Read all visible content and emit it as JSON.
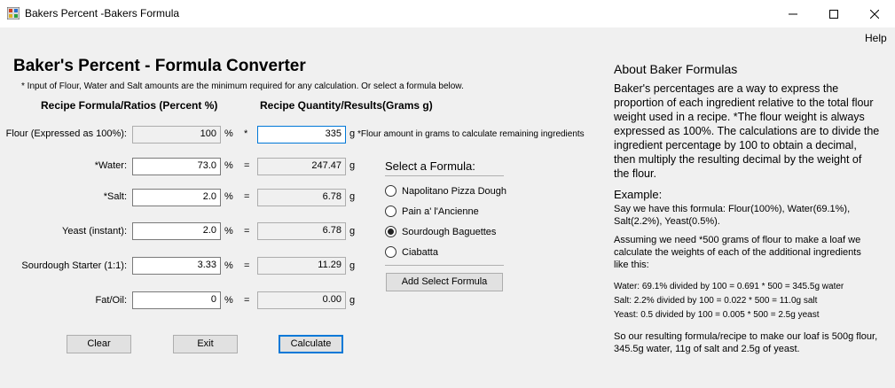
{
  "window": {
    "title": "Bakers Percent -Bakers Formula"
  },
  "menu": {
    "help": "Help"
  },
  "header": {
    "title": "Baker's Percent - Formula Converter",
    "note": "* Input of Flour, Water and Salt amounts are the minimum required for any calculation. Or select a formula below."
  },
  "columns": {
    "ratios": "Recipe Formula/Ratios (Percent %)",
    "results": "Recipe Quantity/Results(Grams g)"
  },
  "rows": [
    {
      "label": "Flour (Expressed as 100%):",
      "percent": "100",
      "pct_sym": "%",
      "op": "*",
      "grams": "335",
      "g_sym": "g"
    },
    {
      "label": "*Water:",
      "percent": "73.0",
      "pct_sym": "%",
      "op": "=",
      "grams": "247.47",
      "g_sym": "g"
    },
    {
      "label": "*Salt:",
      "percent": "2.0",
      "pct_sym": "%",
      "op": "=",
      "grams": "6.78",
      "g_sym": "g"
    },
    {
      "label": "Yeast (instant):",
      "percent": "2.0",
      "pct_sym": "%",
      "op": "=",
      "grams": "6.78",
      "g_sym": "g"
    },
    {
      "label": "Sourdough Starter (1:1):",
      "percent": "3.33",
      "pct_sym": "%",
      "op": "=",
      "grams": "11.29",
      "g_sym": "g"
    },
    {
      "label": "Fat/Oil:",
      "percent": "0",
      "pct_sym": "%",
      "op": "=",
      "grams": "0.00",
      "g_sym": "g"
    }
  ],
  "flour_hint": "*Flour amount in grams to calculate remaining ingredients",
  "formula": {
    "title": "Select a Formula:",
    "options": [
      {
        "label": "Napolitano Pizza Dough",
        "selected": false
      },
      {
        "label": "Pain a' l'Ancienne",
        "selected": false
      },
      {
        "label": "Sourdough Baguettes",
        "selected": true
      },
      {
        "label": "Ciabatta",
        "selected": false
      }
    ],
    "add_button": "Add Select Formula"
  },
  "buttons": {
    "clear": "Clear",
    "exit": "Exit",
    "calculate": "Calculate"
  },
  "about": {
    "title": "About Baker Formulas",
    "body": "Baker's percentages are a way to express the proportion of each ingredient relative to the total flour weight used in a recipe. *The flour weight is always expressed as 100%. The calculations are to divide the ingredient percentage by 100 to obtain a decimal, then multiply the resulting decimal by the weight of the flour.",
    "example_title": "Example:",
    "example_intro": "Say we have this formula: Flour(100%), Water(69.1%), Salt(2.2%), Yeast(0.5%).",
    "assumption": "Assuming we need *500 grams of flour to make a loaf we calculate the weights of each of the additional ingredients like this:",
    "calc_lines": [
      "Water: 69.1% divided by 100 = 0.691 * 500 = 345.5g water",
      "Salt: 2.2% divided by 100 = 0.022 * 500 = 11.0g salt",
      "Yeast: 0.5 divided by 100 = 0.005 * 500 = 2.5g yeast"
    ],
    "conclusion": "So our resulting formula/recipe to make our loaf is 500g flour, 345.5g water, 11g of salt and 2.5g of yeast."
  },
  "colors": {
    "accent": "#0078d7",
    "window_bg": "#f0f0f0"
  }
}
